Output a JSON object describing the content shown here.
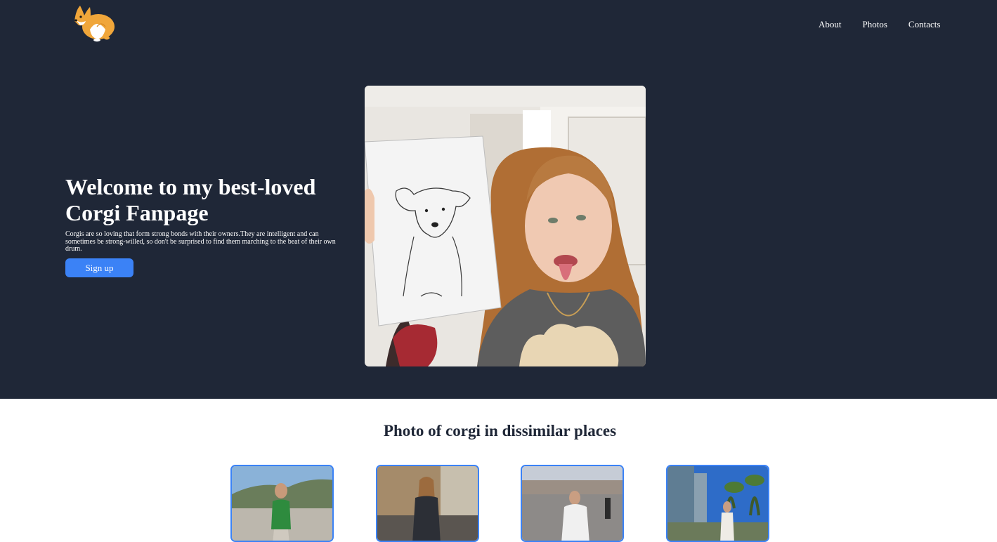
{
  "nav": {
    "links": [
      "About",
      "Photos",
      "Contacts"
    ]
  },
  "hero": {
    "title": "Welcome to my best-loved Corgi Fanpage",
    "description": "Corgis are so loving that form strong bonds with their owners.They are intelligent and can sometimes be strong-willed, so don't be surprised to find them marching to the beat of their own drum.",
    "signup_label": "Sign up"
  },
  "gallery": {
    "title": "Photo of corgi in dissimilar places"
  },
  "colors": {
    "header_bg": "#1f2737",
    "accent": "#3b82f6",
    "text_light": "#ffffff",
    "text_dark": "#1f2737"
  }
}
